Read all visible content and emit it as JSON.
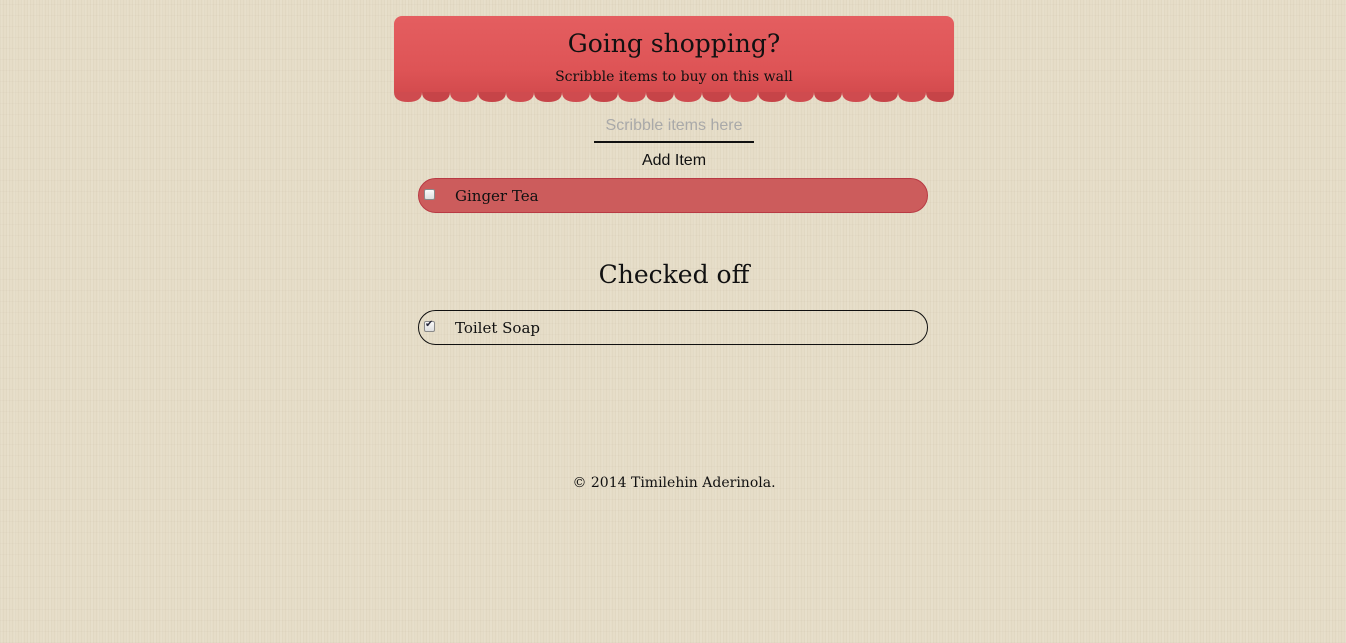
{
  "header": {
    "title": "Going shopping?",
    "subtitle": "Scribble items to buy on this wall"
  },
  "form": {
    "placeholder": "Scribble items here",
    "value": "",
    "add_label": "Add Item"
  },
  "todo_items": [
    {
      "label": "Ginger Tea",
      "checked": false
    }
  ],
  "checked_section": {
    "title": "Checked off",
    "items": [
      {
        "label": "Toilet Soap",
        "checked": true
      }
    ]
  },
  "footer": {
    "copyright": "© 2014 Timilehin Aderinola."
  },
  "colors": {
    "awning": "#e05a5c",
    "todo_item_bg": "#cc5c5c",
    "background": "#e6ddc8"
  },
  "icons": {
    "checked": "check-icon"
  }
}
